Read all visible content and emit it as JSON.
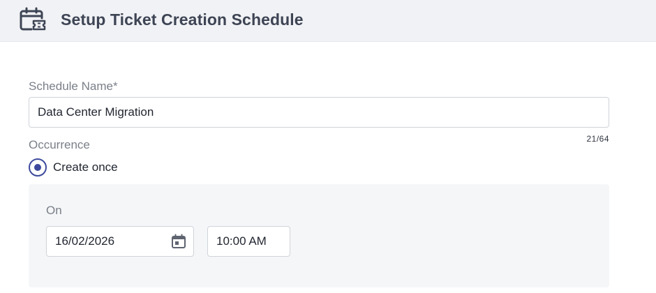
{
  "header": {
    "title": "Setup Ticket Creation Schedule",
    "icon": "calendar-ticket-icon"
  },
  "form": {
    "schedule_name": {
      "label": "Schedule Name*",
      "value": "Data Center Migration",
      "char_count": "21/64"
    },
    "occurrence": {
      "label": "Occurrence",
      "options": [
        {
          "label": "Create once",
          "selected": true
        }
      ]
    },
    "schedule": {
      "on_label": "On",
      "date": "16/02/2026",
      "time": "10:00 AM",
      "date_icon": "calendar-icon"
    }
  },
  "colors": {
    "header_bg": "#f1f2f5",
    "accent": "#3d4a9c",
    "panel_bg": "#f5f6f8",
    "label_text": "#7a7f88",
    "title_text": "#3d4454"
  }
}
